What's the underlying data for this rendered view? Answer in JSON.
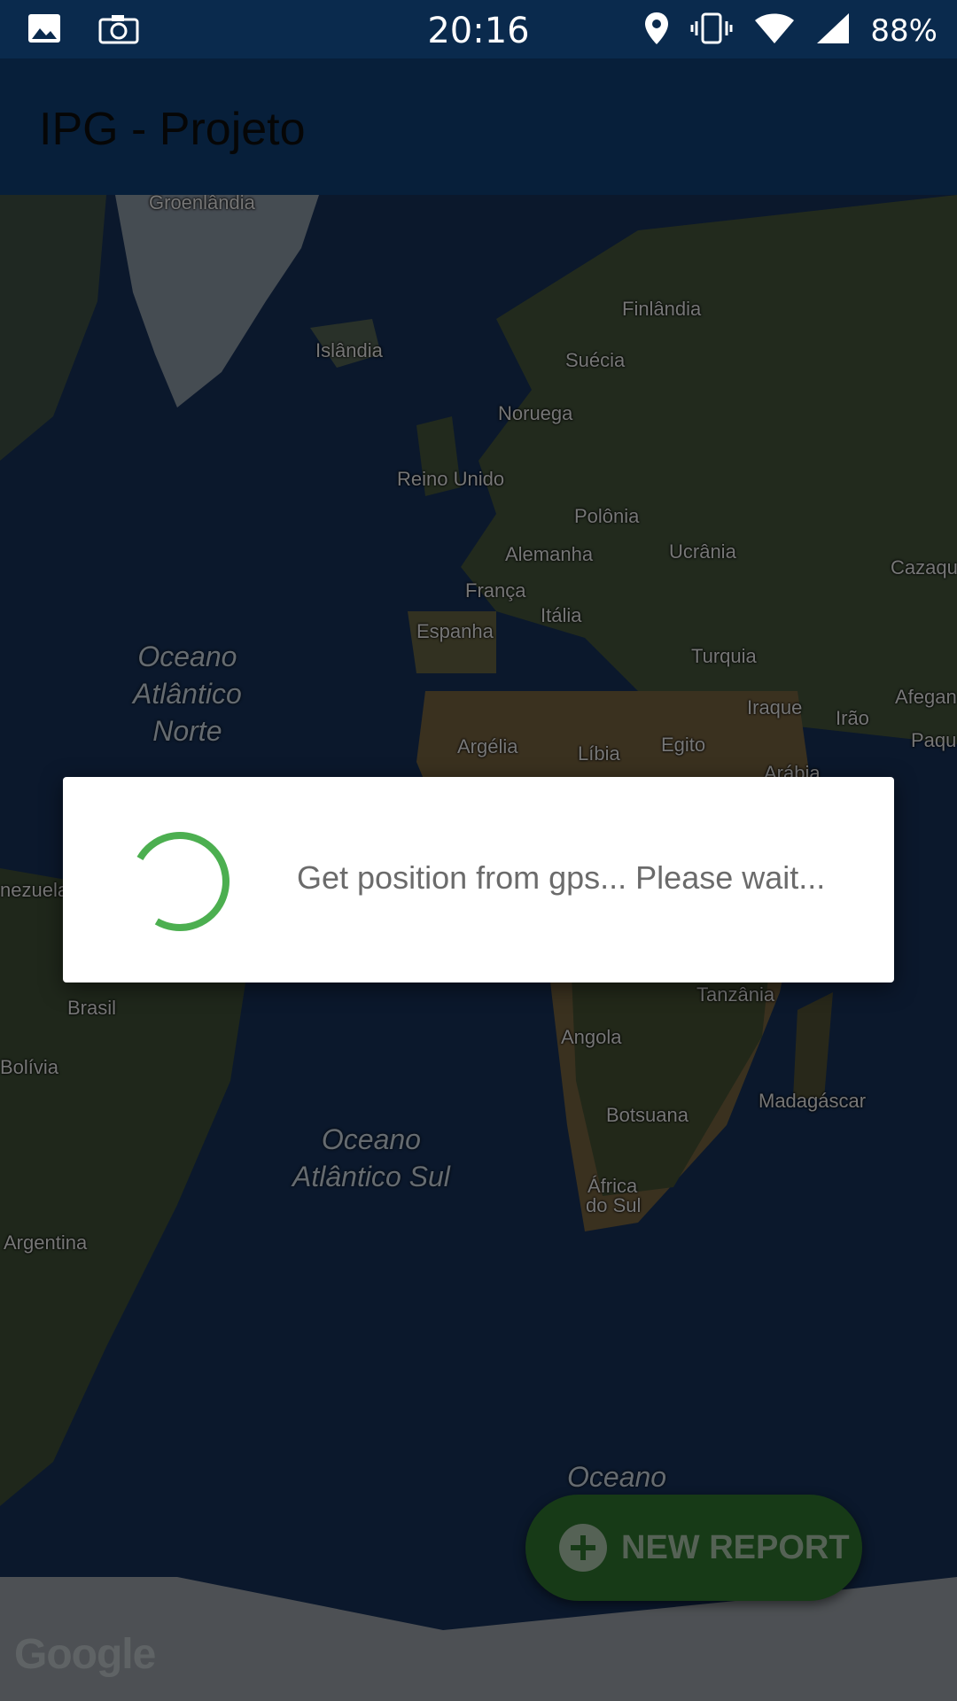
{
  "status_bar": {
    "time": "20:16",
    "battery": "88%",
    "icons": [
      "gallery-icon",
      "camera-icon",
      "location-icon",
      "vibrate-icon",
      "wifi-icon",
      "signal-icon"
    ]
  },
  "app_bar": {
    "title": "IPG - Projeto"
  },
  "map": {
    "labels": {
      "groenlandia": "Groenlândia",
      "islandia": "Islândia",
      "finlandia": "Finlândia",
      "suecia": "Suécia",
      "noruega": "Noruega",
      "reino_unido": "Reino Unido",
      "polonia": "Polônia",
      "alemanha": "Alemanha",
      "ucrania": "Ucrânia",
      "cazaq": "Cazaqu",
      "franca": "França",
      "italia": "Itália",
      "espanha": "Espanha",
      "turquia": "Turquia",
      "iraque": "Iraque",
      "irao": "Irão",
      "afegan": "Afegan",
      "paqu": "Paqu",
      "argelia": "Argélia",
      "libia": "Líbia",
      "egito": "Egito",
      "arabia": "Arábia",
      "venezuela": "nezuela",
      "brasil": "Brasil",
      "bolivia": "Bolívia",
      "argentina": "Argentina",
      "tanzania": "Tanzânia",
      "angola": "Angola",
      "madagascar": "Madagáscar",
      "botsuana": "Botsuana",
      "africa_do_sul_1": "África",
      "africa_do_sul_2": "do Sul"
    },
    "oceans": {
      "norte_1": "Oceano",
      "norte_2": "Atlântico",
      "norte_3": "Norte",
      "sul_1": "Oceano",
      "sul_2": "Atlântico Sul",
      "south": "Oceano"
    },
    "attribution": "Google"
  },
  "dialog": {
    "message": "Get position from gps... Please wait..."
  },
  "fab": {
    "label": "NEW REPORT"
  },
  "colors": {
    "spinner": "#4caf50",
    "app_bar": "#0d3a6a",
    "fab": "#2a6b2a"
  }
}
